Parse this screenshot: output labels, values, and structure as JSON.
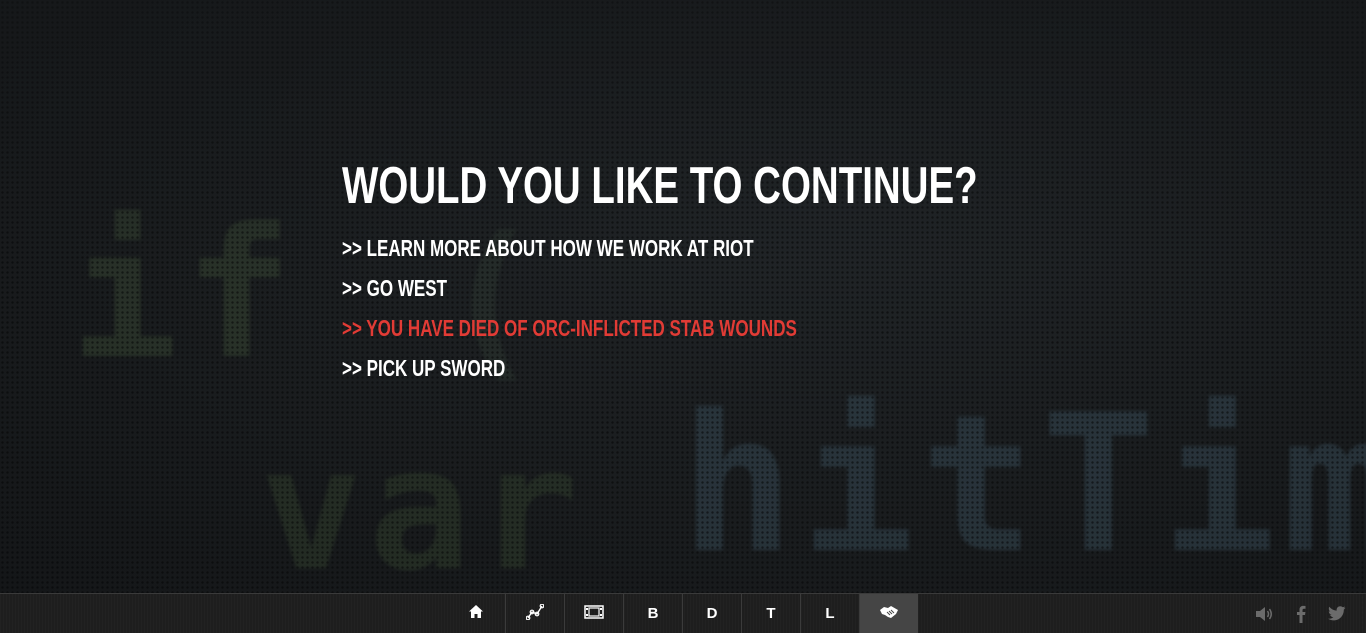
{
  "background": {
    "code_fragments": [
      "if",
      "(",
      "var",
      "hitTime"
    ]
  },
  "prompt": {
    "headline": "WOULD YOU LIKE TO CONTINUE?",
    "options": [
      {
        "label": ">> LEARN MORE ABOUT HOW WE WORK AT RIOT",
        "highlighted": false
      },
      {
        "label": ">> GO WEST",
        "highlighted": false
      },
      {
        "label": ">> YOU HAVE DIED OF ORC-INFLICTED STAB WOUNDS",
        "highlighted": true
      },
      {
        "label": ">> PICK UP SWORD",
        "highlighted": false
      }
    ]
  },
  "footer_nav": {
    "items": [
      {
        "icon": "home-icon"
      },
      {
        "icon": "graph-icon"
      },
      {
        "icon": "film-icon"
      },
      {
        "label": "B"
      },
      {
        "label": "D"
      },
      {
        "label": "T"
      },
      {
        "label": "L"
      },
      {
        "icon": "handshake-icon",
        "current": true
      }
    ]
  },
  "social": {
    "icons": [
      "volume-icon",
      "facebook-icon",
      "twitter-icon"
    ]
  },
  "colors": {
    "accent": "#e13b35",
    "text": "#ffffff",
    "footer_bg": "#1e1e1e",
    "nav_current_bg": "#454545",
    "icon_muted": "#6b6b6b"
  }
}
